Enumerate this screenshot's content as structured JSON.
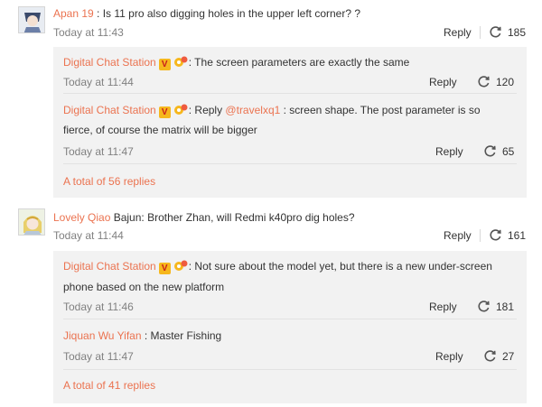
{
  "comments": [
    {
      "author": "Apan 19",
      "text": " : Is 11 pro also digging holes in the upper left corner? ?",
      "time": "Today at 11:43",
      "reply_label": "Reply",
      "repost_count": "185",
      "replies": [
        {
          "author": "Digital Chat Station",
          "text_line1": ": The screen parameters are exactly the same",
          "time": "Today at 11:44",
          "reply_label": "Reply",
          "repost_count": "120"
        },
        {
          "author": "Digital Chat Station",
          "prefix": ":  Reply ",
          "mention": "@travelxq1",
          "text_line1": " : screen shape. The post parameter is so",
          "text_line2": "fierce, of course the matrix will be bigger",
          "time": "Today at 11:47",
          "reply_label": "Reply",
          "repost_count": "65"
        }
      ],
      "more": "A total of 56 replies"
    },
    {
      "author": "Lovely Qiao",
      "text": " Bajun: Brother Zhan, will Redmi k40pro dig holes?",
      "time": "Today at 11:44",
      "reply_label": "Reply",
      "repost_count": "161",
      "replies": [
        {
          "author": "Digital Chat Station",
          "text_line1": ": Not sure about the model yet, but there is a new under-screen",
          "text_line2": "phone based on the new platform",
          "time": "Today at 11:46",
          "reply_label": "Reply",
          "repost_count": "181"
        },
        {
          "author": "Jiquan Wu Yifan",
          "text_line1": " : Master Fishing",
          "time": "Today at 11:47",
          "reply_label": "Reply",
          "repost_count": "27"
        }
      ],
      "more": "A total of 41 replies"
    }
  ],
  "badges": {
    "verified": "V"
  },
  "colors": {
    "link": "#eb7350",
    "reply_bg": "#f2f2f2",
    "badge_bg": "#f6b71d",
    "badge_fg": "#c81d1d"
  },
  "icons": {
    "repost": "repost-icon",
    "verified": "verified-badge-icon",
    "member": "member-badge-icon"
  }
}
